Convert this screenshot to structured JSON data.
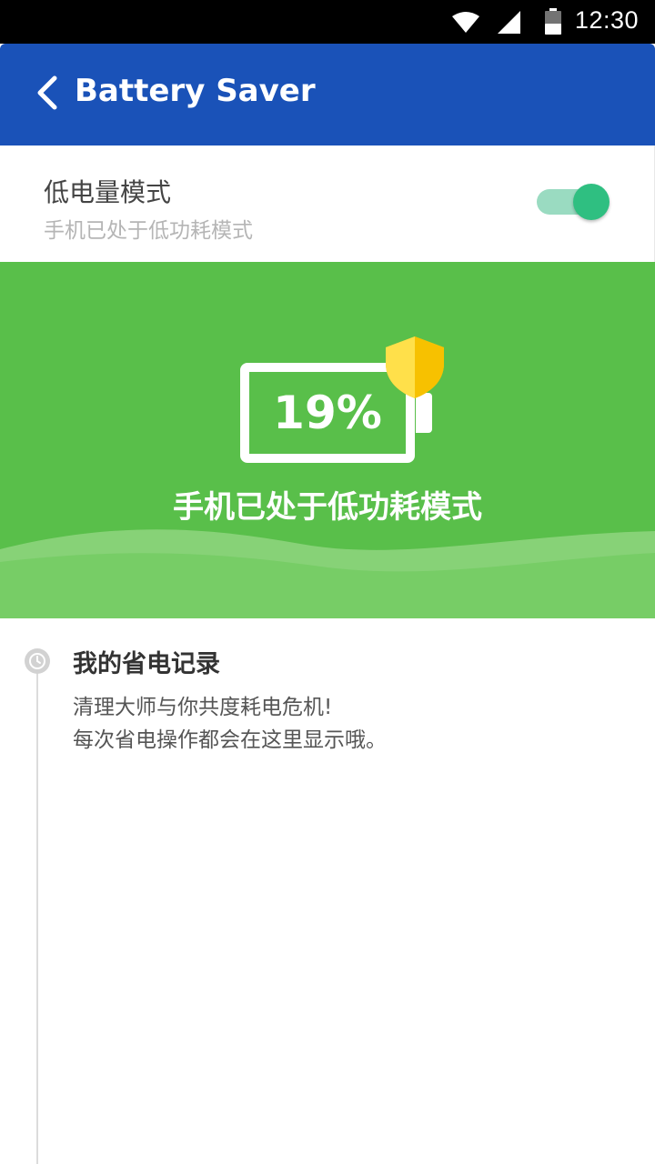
{
  "status_bar": {
    "time": "12:30",
    "icons": [
      "wifi-icon",
      "signal-icon",
      "battery-icon"
    ]
  },
  "app_bar": {
    "title": "Battery Saver",
    "back_icon": "back-arrow-icon",
    "color": "#1a52b8"
  },
  "low_power_mode": {
    "title": "低电量模式",
    "subtitle": "手机已处于低功耗模式",
    "enabled": true,
    "toggle_color": "#2fbf81"
  },
  "hero": {
    "battery_level": "19%",
    "message": "手机已处于低功耗模式",
    "background_color": "#59bf4a",
    "badge_icon": "shield-icon"
  },
  "history": {
    "title": "我的省电记录",
    "lines": [
      "清理大师与你共度耗电危机!",
      "每次省电操作都会在这里显示哦。"
    ],
    "icon": "clock-icon"
  }
}
